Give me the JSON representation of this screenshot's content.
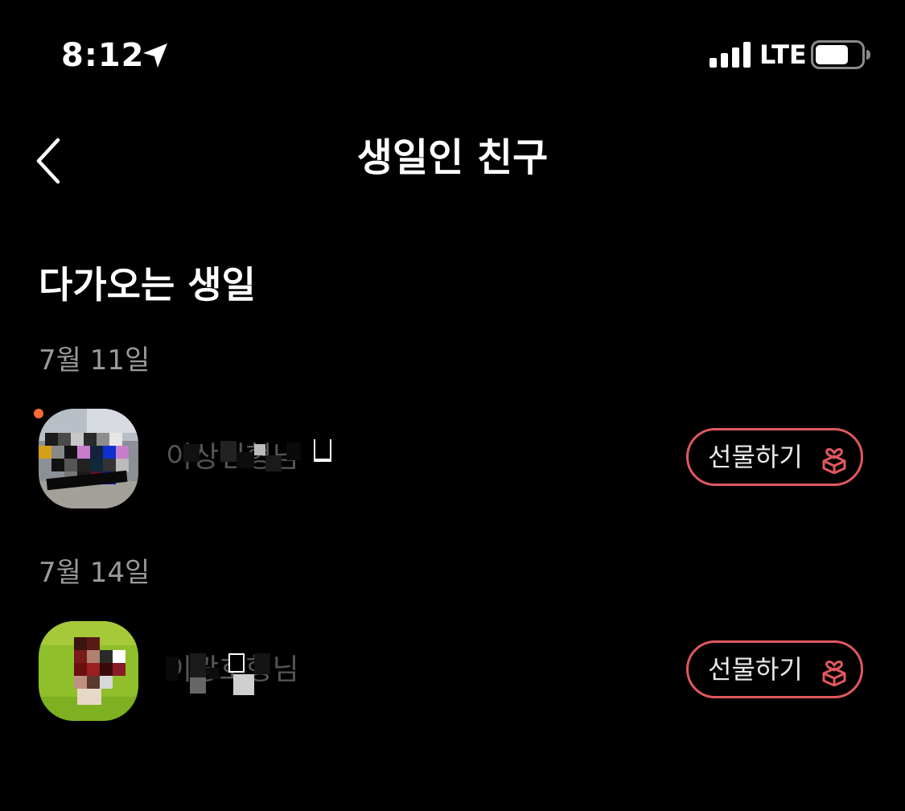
{
  "status_bar": {
    "time": "8:12",
    "network": "LTE",
    "icons": [
      "location-arrow-icon",
      "signal-bars-icon",
      "battery-icon"
    ]
  },
  "nav": {
    "title": "생일인 친구",
    "back_icon": "chevron-left-icon"
  },
  "section": {
    "title": "다가오는 생일"
  },
  "groups": [
    {
      "date": "7월 11일",
      "friend": {
        "name": "이상민형님",
        "has_new_dot": true
      },
      "gift_label": "선물하기",
      "gift_icon": "gift-box-icon"
    },
    {
      "date": "7월 14일",
      "friend": {
        "name": "이광호형님",
        "has_new_dot": false
      },
      "gift_label": "선물하기",
      "gift_icon": "gift-box-icon"
    }
  ],
  "colors": {
    "background": "#000000",
    "accent": "#e0585e",
    "date_text": "#9a9a9a",
    "new_dot": "#ff6b35"
  }
}
